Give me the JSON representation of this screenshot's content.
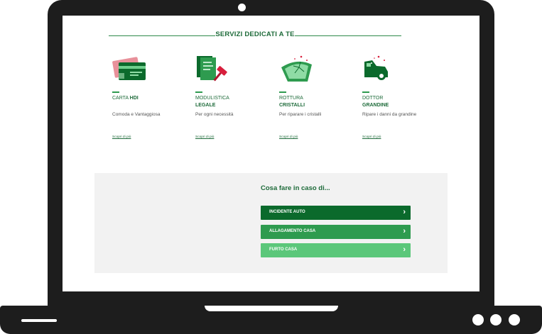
{
  "section": {
    "title": "SERVIZI DEDICATI A TE"
  },
  "cards": [
    {
      "title_line1": "CARTA",
      "title_bold": "HDI",
      "description": "Comoda e Vantaggiosa",
      "link": "Scopri di più",
      "icon": "credit-card-icon"
    },
    {
      "title_line1": "MODULISTICA",
      "title_bold": "LEGALE",
      "description": "Per ogni necessità",
      "link": "Scopri di più",
      "icon": "legal-documents-gavel-icon"
    },
    {
      "title_line1": "ROTTURA",
      "title_bold": "CRISTALLI",
      "description": "Per riparare i cristalli",
      "link": "Scopri di più",
      "icon": "broken-windshield-icon"
    },
    {
      "title_line1": "DOTTOR",
      "title_bold": "GRANDINE",
      "description": "Ripare i danni da grandine",
      "link": "Scopri di più",
      "icon": "hail-car-icon"
    }
  ],
  "what_to_do": {
    "title": "Cosa fare in caso di...",
    "buttons": [
      {
        "label": "INCIDENTE AUTO",
        "color": "#0b6a2c"
      },
      {
        "label": "ALLAGAMENTO CASA",
        "color": "#2e9b4f"
      },
      {
        "label": "FURTO CASA",
        "color": "#5bc77a"
      }
    ]
  },
  "colors": {
    "brand_green": "#1e6b3a",
    "laptop_frame": "#1d1d1d",
    "panel_bg": "#f2f2f2"
  }
}
